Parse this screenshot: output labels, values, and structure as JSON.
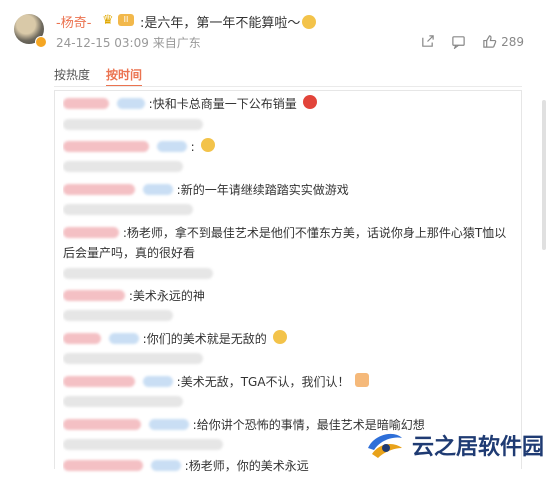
{
  "post": {
    "author": "-杨奇-",
    "text": ":是六年，第一年不能算啦～",
    "timestamp": "24-12-15 03:09",
    "location": "来自广东",
    "like_count": "289",
    "badge_level": "II",
    "icons": [
      "share-icon",
      "comment-icon",
      "like-icon"
    ]
  },
  "tabs": [
    {
      "label": "按热度",
      "active": false
    },
    {
      "label": "按时间",
      "active": true
    }
  ],
  "comments": [
    {
      "text": ":快和卡总商量一下公布销量"
    },
    {
      "text": ""
    },
    {
      "text": ":"
    },
    {
      "text": ""
    },
    {
      "text": ":新的一年请继续踏踏实实做游戏"
    },
    {
      "text": ""
    },
    {
      "text": ":杨老师，拿不到最佳艺术是他们不懂东方美，话说你身上那件心猿T恤以"
    },
    {
      "text": "后会量产吗，真的很好看"
    },
    {
      "text": ""
    },
    {
      "text": ":美术永远的神"
    },
    {
      "text": ""
    },
    {
      "text": ":你们的美术就是无敌的"
    },
    {
      "text": ""
    },
    {
      "text": ":美术无敌，TGA不认，我们认！"
    },
    {
      "text": ""
    },
    {
      "text": ":给你讲个恐怖的事情，最佳艺术是暗喻幻想"
    },
    {
      "text": ""
    },
    {
      "text": ":杨老师，你的美术永远"
    }
  ],
  "watermark": {
    "text": "云之居软件园"
  },
  "colors": {
    "accent": "#eb7350",
    "meta": "#999999",
    "border": "#e6e6e6"
  }
}
